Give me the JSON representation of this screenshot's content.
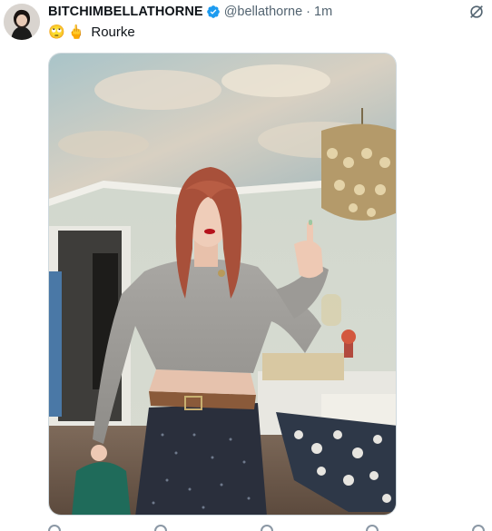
{
  "tweet": {
    "display_name": "BITCHIMBELLATHORNE",
    "handle": "@bellathorne",
    "separator": "·",
    "time": "1m",
    "emoji_1": "🙄",
    "emoji_2": "🖕",
    "text": "Rourke",
    "verified": true,
    "avatar_icon": "profile-photo",
    "grok_icon": "grok-icon",
    "media_description_icon": "photo"
  },
  "colors": {
    "verified_blue": "#1d9bf0",
    "secondary_text": "#536471",
    "primary_text": "#0f1419"
  }
}
